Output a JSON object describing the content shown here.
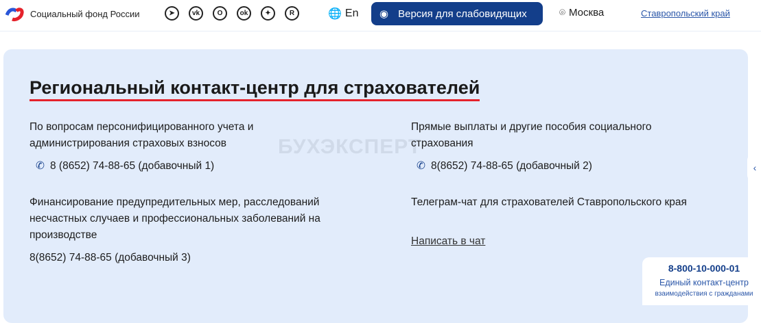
{
  "header": {
    "logo_text": "Социальный фонд России",
    "socials": [
      "telegram-icon",
      "vk-icon",
      "max-icon",
      "ok-icon",
      "dzen-icon",
      "rutube-icon"
    ],
    "lang": "En",
    "vision_button": "Версия для слабовидящих",
    "city": "Москва",
    "region": "Ставропольский край"
  },
  "main": {
    "title": "Региональный контакт-центр для страхователей",
    "blocks": [
      {
        "text": "По вопросам персонифицированного учета и администрирования страховых взносов",
        "phone": "8 (8652) 74-88-65 (добавочный 1)"
      },
      {
        "text": "Прямые выплаты и другие пособия социального страхования",
        "phone": "8(8652) 74-88-65 (добавочный 2)"
      },
      {
        "text": "Финансирование предупредительных мер, расследований несчастных случаев и профессиональных заболеваний на производстве",
        "phone": "8(8652) 74-88-65 (добавочный 3)"
      },
      {
        "text": "Телеграм-чат для страхователей Ставропольского края",
        "link": "Написать в чат"
      }
    ]
  },
  "watermark": "БУХЭКСПЕРТ",
  "hotline": {
    "number": "8-800-10-000-01",
    "title": "Единый контакт-центр",
    "subtitle": "взаимодействия с гражданами"
  },
  "colors": {
    "accent": "#133e8a",
    "panel": "#e2ecfb",
    "underline": "#e5222b"
  }
}
